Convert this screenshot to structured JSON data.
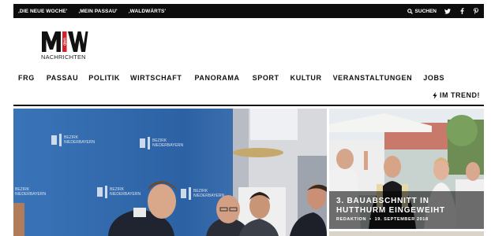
{
  "topbar": {
    "links": [
      "‚DIE NEUE WOCHE'",
      "‚MEIN PASSAU'",
      "‚WALDWÄRTS'"
    ],
    "search_label": "SUCHEN",
    "social_icons": [
      "twitter-icon",
      "facebook-icon",
      "pinterest-icon"
    ]
  },
  "logo": {
    "letters_top": "M",
    "letters_right": "W",
    "und": "UND",
    "subtitle": "NACHRICHTEN",
    "accent": "#d4202a"
  },
  "nav": {
    "items": [
      "FRG",
      "PASSAU",
      "POLITIK",
      "WIRTSCHAFT",
      "PANORAMA",
      "SPORT",
      "KULTUR",
      "VERANSTALTUNGEN",
      "JOBS"
    ],
    "trend_label": "IM TREND!"
  },
  "hero": {
    "banner_lines": [
      "BEZIRK",
      "NIEDERBAYERN"
    ]
  },
  "side_story": {
    "title_line1": "3. BAUABSCHNITT IN",
    "title_line2": "HUTTHURM EINGEWEIHT",
    "author": "REDAKTION",
    "separator": "•",
    "date": "19. SEPTEMBER 2018"
  },
  "colors": {
    "topbar_bg": "#0d0d0d",
    "hero_blue": "#2f67a8",
    "logo_red": "#d4202a"
  }
}
